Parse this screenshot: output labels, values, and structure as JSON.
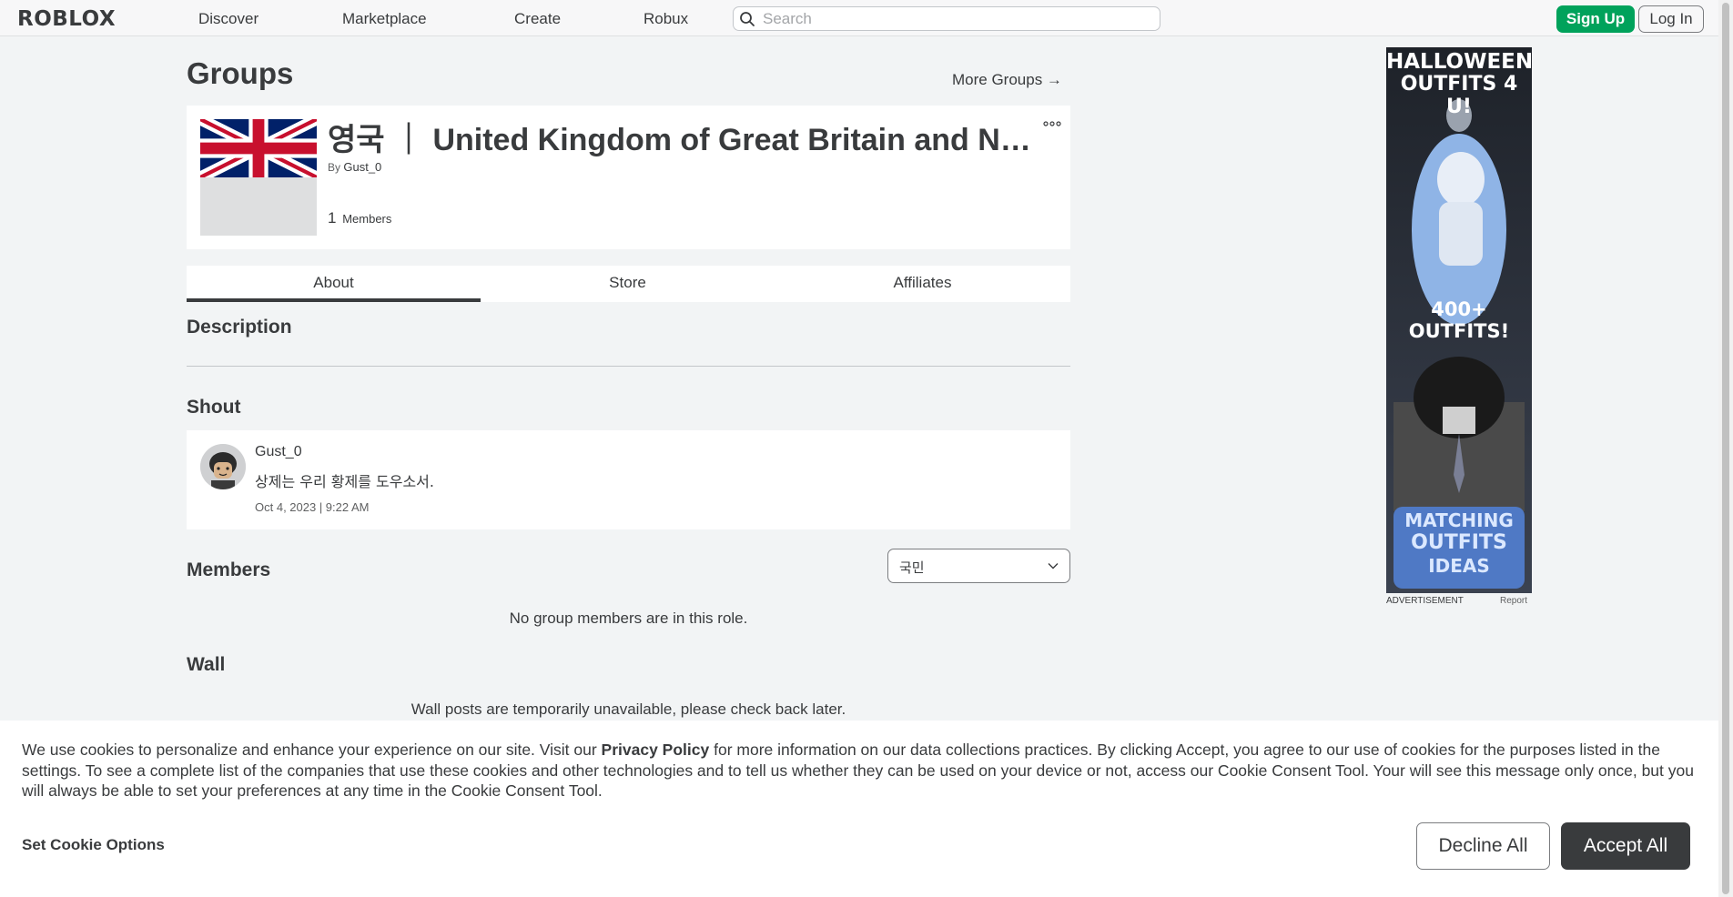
{
  "header": {
    "logo": "ROBLOX",
    "nav": [
      "Discover",
      "Marketplace",
      "Create",
      "Robux"
    ],
    "search_placeholder": "Search",
    "signup_label": "Sign Up",
    "login_label": "Log In"
  },
  "page": {
    "title": "Groups",
    "more_groups": "More Groups →"
  },
  "group": {
    "name": "영국 ｜ United Kingdom of Great Britain and Northern Ireland",
    "by_label": "By",
    "owner": "Gust_0",
    "member_count": "1",
    "members_label": "Members"
  },
  "tabs": [
    "About",
    "Store",
    "Affiliates"
  ],
  "sections": {
    "description": "Description",
    "shout": "Shout",
    "members": "Members",
    "wall": "Wall"
  },
  "shout": {
    "user": "Gust_0",
    "text": "상제는 우리 황제를 도우소서.",
    "date": "Oct 4, 2023 | 9:22 AM"
  },
  "members": {
    "selected_role": "국민",
    "empty_message": "No group members are in this role."
  },
  "wall": {
    "message": "Wall posts are temporarily unavailable, please check back later."
  },
  "ad": {
    "line1": "HALLOWEEN",
    "line2": "OUTFITS 4 U!",
    "line3": "400+ OUTFITS!",
    "line4": "MATCHING",
    "line5": "OUTFITS",
    "line6": "IDEAS",
    "label": "ADVERTISEMENT",
    "report": "Report"
  },
  "cookie": {
    "text_before": "We use cookies to personalize and enhance your experience on our site. Visit our ",
    "link": "Privacy Policy",
    "text_after": " for more information on our data collections practices. By clicking Accept, you agree to our use of cookies for the purposes listed in the settings. To see a complete list of the companies that use these cookies and other technologies and to tell us whether they can be used on your device or not, access our Cookie Consent Tool. Your will see this message only once, but you will always be able to set your preferences at any time in the Cookie Consent Tool.",
    "options_label": "Set Cookie Options",
    "decline_label": "Decline All",
    "accept_label": "Accept All"
  },
  "colors": {
    "signup_green": "#00a25b",
    "text_dark": "#393b3d",
    "page_bg": "#f2f4f5"
  }
}
